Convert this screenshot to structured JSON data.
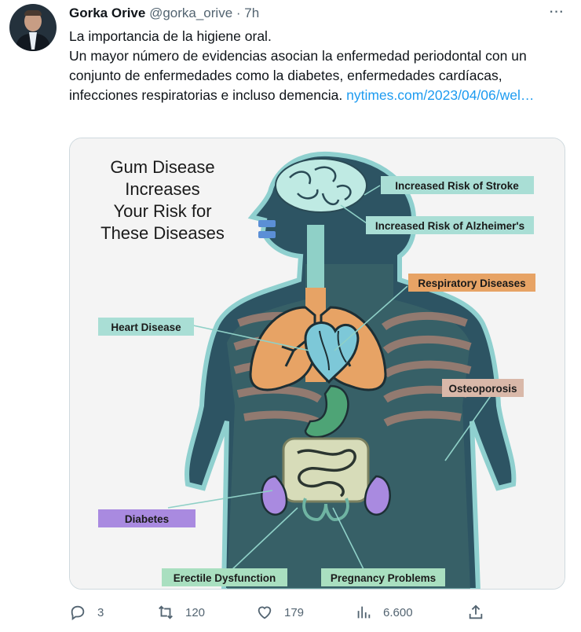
{
  "tweet": {
    "author_name": "Gorka Orive",
    "author_handle": "@gorka_orive",
    "separator": "·",
    "time": "7h",
    "more_icon": "more-dots-icon",
    "text_line_1": "La importancia de la higiene oral.",
    "text_line_2": "Un mayor número de evidencias asocian la enfermedad periodontal con un conjunto de enfermedades como la diabetes, enfermedades cardíacas, infecciones respiratorias e incluso demencia.",
    "link_text": "nytimes.com/2023/04/06/wel…"
  },
  "infographic": {
    "title_lines": [
      "Gum Disease",
      "Increases",
      "Your Risk for",
      "These Diseases"
    ],
    "labels": {
      "stroke": "Increased Risk of Stroke",
      "alzheimers": "Increased Risk of Alzheimer's",
      "respiratory": "Respiratory Diseases",
      "heart": "Heart Disease",
      "osteoporosis": "Osteoporosis",
      "diabetes": "Diabetes",
      "erectile": "Erectile Dysfunction",
      "pregnancy": "Pregnancy Problems"
    },
    "colors": {
      "teal": "#a9ded5",
      "orange": "#e7a365",
      "purple": "#a98ae0",
      "rose": "#d9b8a9",
      "green": "#a9dfc0"
    }
  },
  "actions": {
    "replies": "3",
    "retweets": "120",
    "likes": "179",
    "views": "6.600"
  }
}
